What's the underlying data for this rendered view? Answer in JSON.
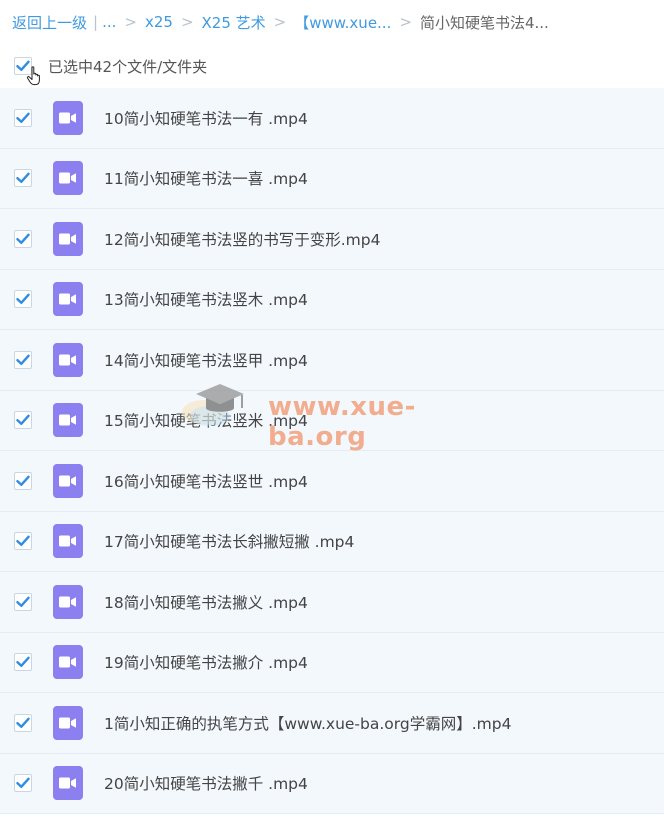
{
  "breadcrumb": {
    "back_label": "返回上一级",
    "pipe": "|",
    "ellipsis": "...",
    "sep": ">",
    "items": [
      "x25",
      "X25 艺术",
      "【www.xue..."
    ],
    "current": "简小知硬笔书法4..."
  },
  "selection": {
    "label": "已选中42个文件/文件夹",
    "checked": true
  },
  "files": [
    {
      "name": "10简小知硬笔书法一有 .mp4",
      "checked": true
    },
    {
      "name": "11简小知硬笔书法一喜 .mp4",
      "checked": true
    },
    {
      "name": "12简小知硬笔书法竖的书写于变形.mp4",
      "checked": true
    },
    {
      "name": "13简小知硬笔书法竖木 .mp4",
      "checked": true
    },
    {
      "name": "14简小知硬笔书法竖甲 .mp4",
      "checked": true
    },
    {
      "name": "15简小知硬笔书法竖米 .mp4",
      "checked": true
    },
    {
      "name": "16简小知硬笔书法竖世 .mp4",
      "checked": true
    },
    {
      "name": "17简小知硬笔书法长斜撇短撇 .mp4",
      "checked": true
    },
    {
      "name": "18简小知硬笔书法撇义 .mp4",
      "checked": true
    },
    {
      "name": "19简小知硬笔书法撇介 .mp4",
      "checked": true
    },
    {
      "name": "1简小知正确的执笔方式【www.xue-ba.org学霸网】.mp4",
      "checked": true
    },
    {
      "name": "20简小知硬笔书法撇千 .mp4",
      "checked": true
    }
  ],
  "watermark": {
    "text": "www.xue-ba.org"
  },
  "colors": {
    "accent": "#3f9ae0",
    "checkmark": "#2f8de4",
    "video_icon": "#8c7ff0",
    "row_bg": "#f3f8fd"
  },
  "icons": {
    "file": "video-file-icon",
    "check": "checkmark-icon",
    "cursor": "hand-pointer-icon"
  }
}
